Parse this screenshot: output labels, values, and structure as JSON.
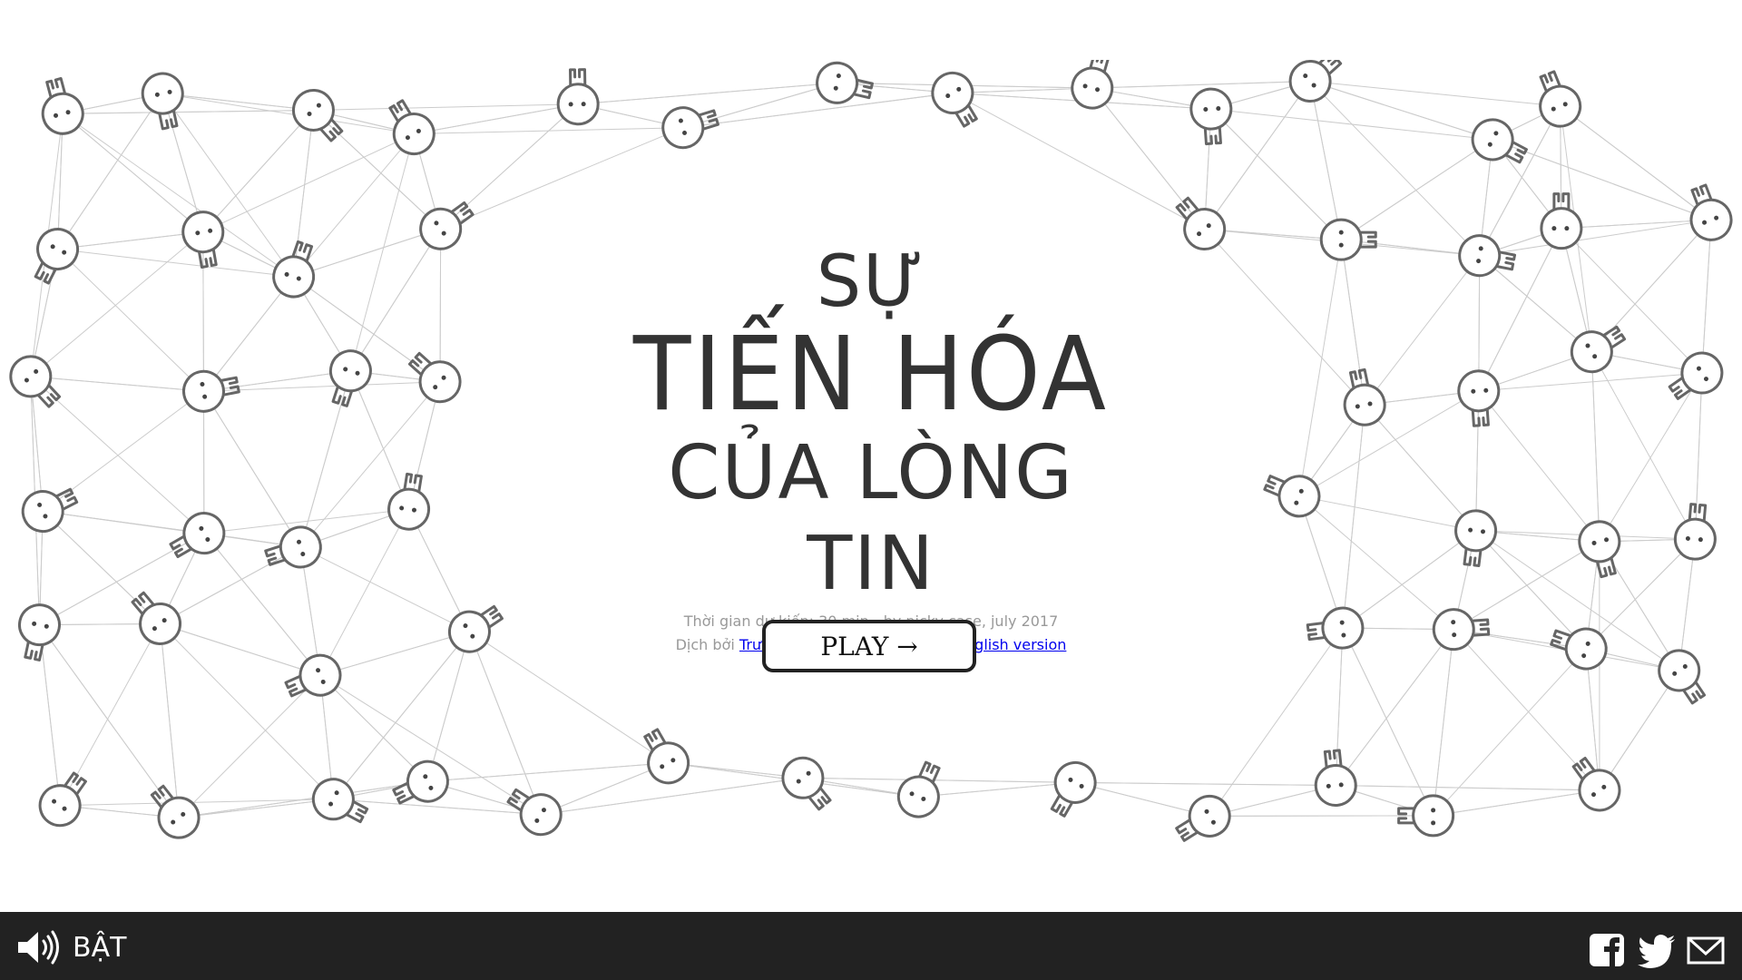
{
  "title": {
    "line1": "SỰ",
    "line2": "TIẾN HÓA",
    "line3": "CỦA LÒNG TIN"
  },
  "meta": {
    "duration": "Thời gian dự kiến: 30 min - by nicky case, july 2017",
    "translated_by": "Dịch bởi",
    "translator": "Trương Trung Nghĩa",
    "separator": "-",
    "original": "Original English version"
  },
  "play_button": {
    "label": "PLAY →"
  },
  "footer": {
    "sound_icon": "speaker-icon",
    "sound_label": "BẬT",
    "share_icons": [
      "facebook-icon",
      "twitter-icon",
      "email-icon"
    ]
  },
  "colors": {
    "text": "#333333",
    "footer_bg": "#222222",
    "character_stroke": "#666666",
    "edge": "#cccccc",
    "link": "#0000ee"
  }
}
